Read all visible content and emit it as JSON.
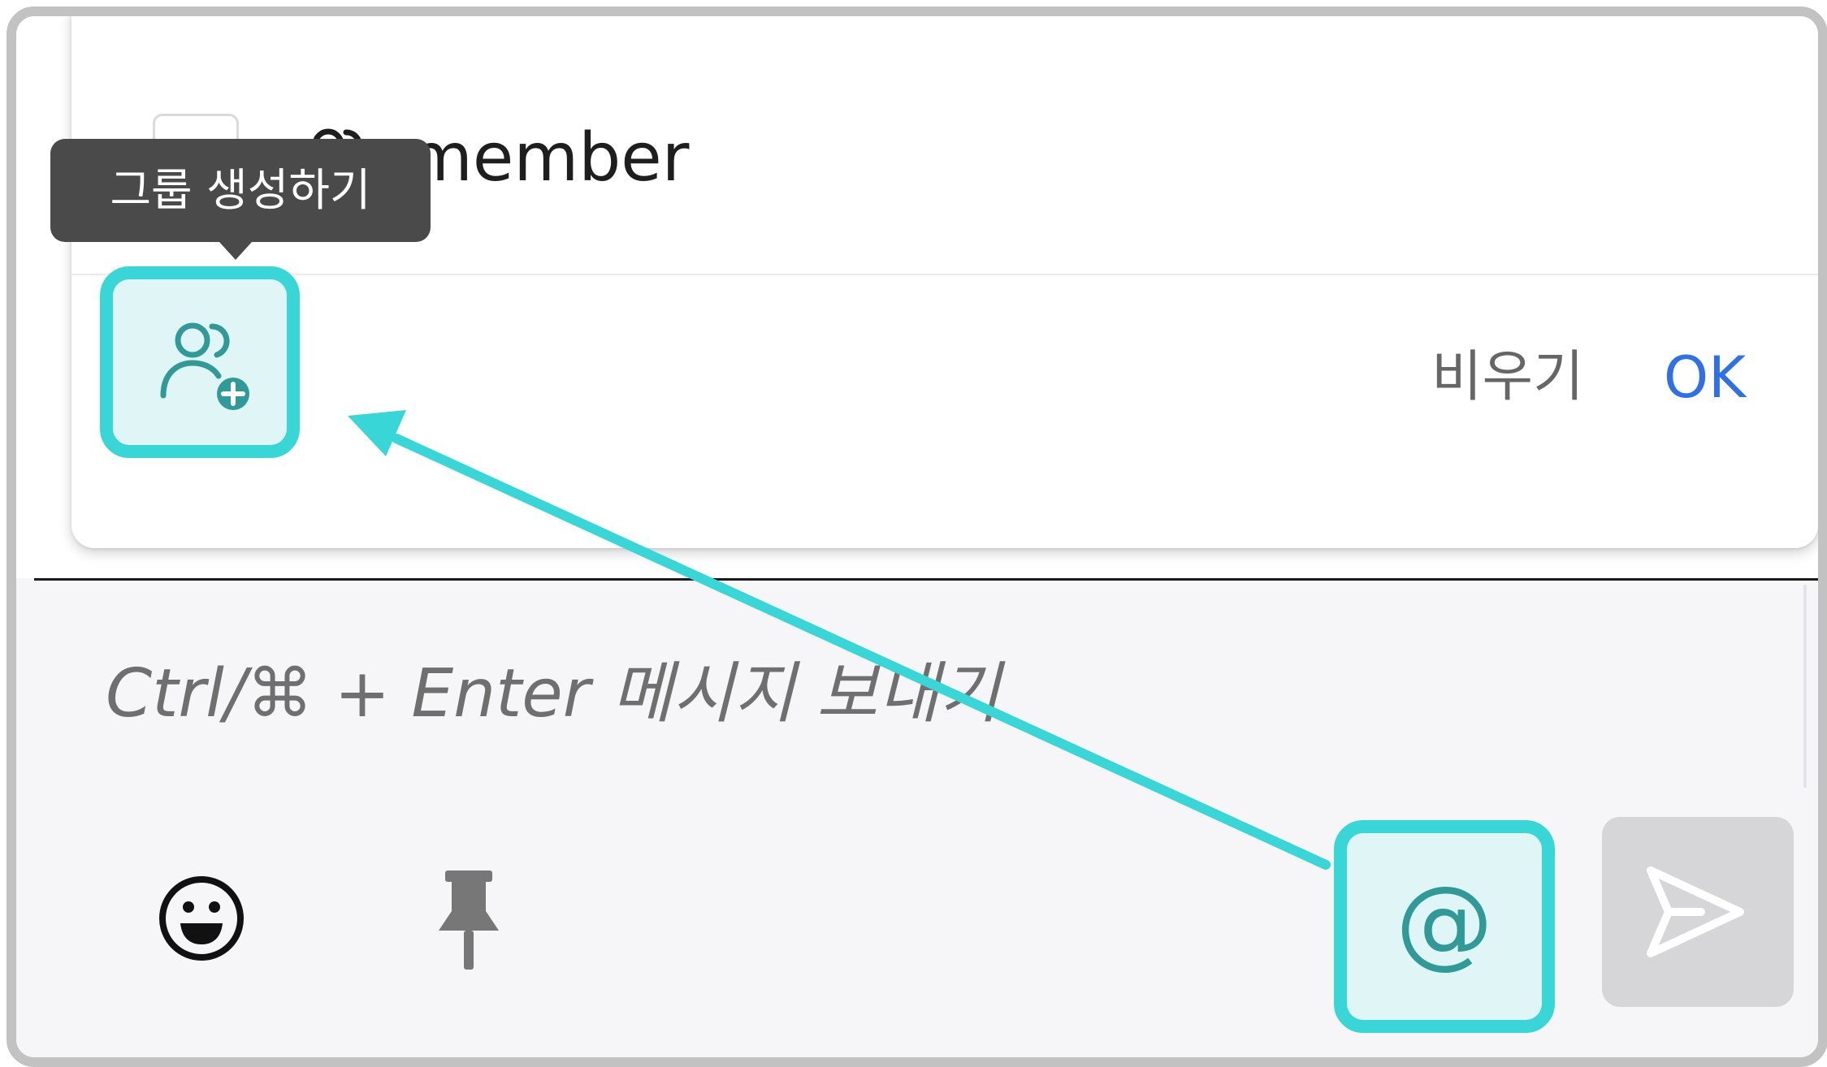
{
  "member_row": {
    "label": "member",
    "icon": "users-icon"
  },
  "tooltip": {
    "text": "그룹 생성하기"
  },
  "group_button": {
    "icon": "user-group-add-icon"
  },
  "actions": {
    "clear_label": "비우기",
    "ok_label": "OK"
  },
  "composer": {
    "placeholder": "Ctrl/⌘ + Enter 메시지 보내기",
    "emoji_icon": "smile-icon",
    "pin_icon": "pin-icon",
    "mention_symbol": "@",
    "send_icon": "send-icon"
  },
  "colors": {
    "highlight": "#39d6d8",
    "highlight_fill": "#dff5f6",
    "icon_teal": "#2f9a97",
    "ok_blue": "#2f6fe8",
    "tooltip_bg": "#4a4a4a"
  }
}
